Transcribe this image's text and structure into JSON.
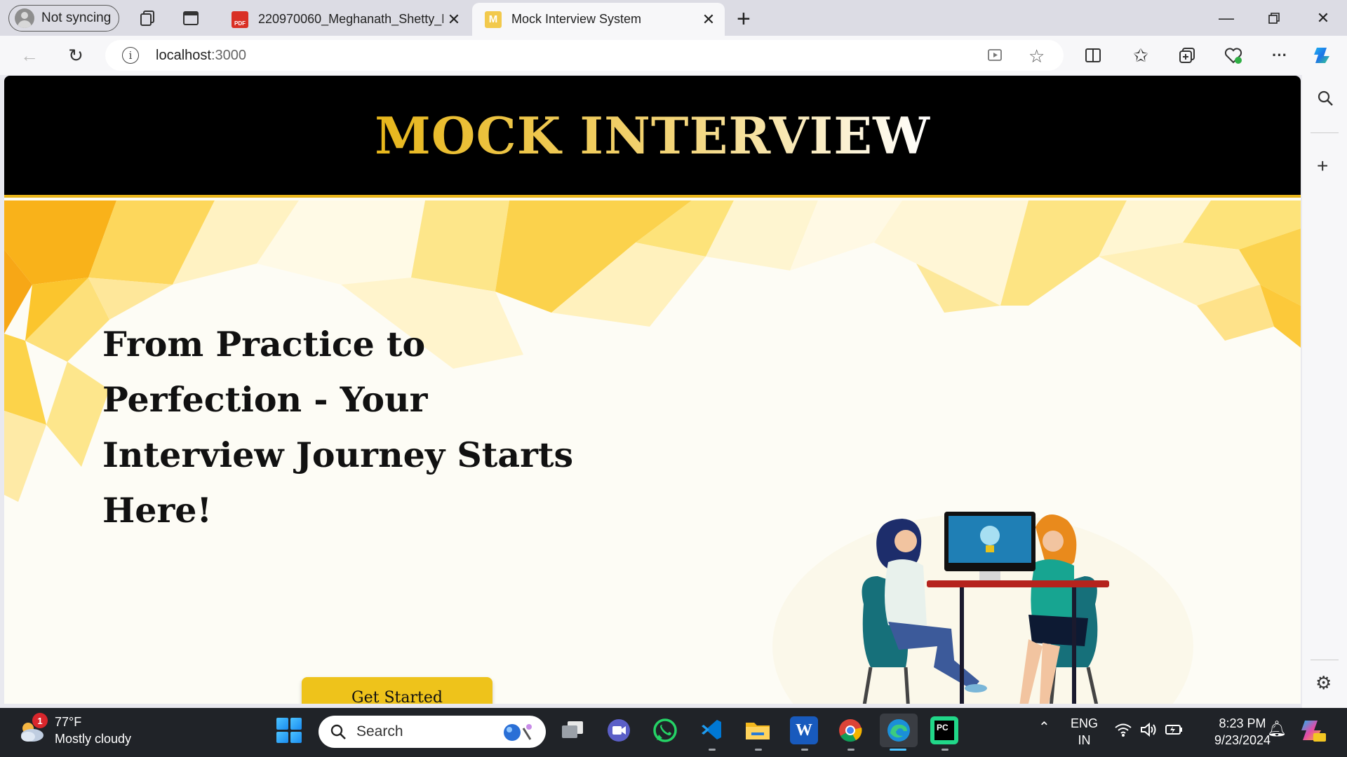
{
  "browser": {
    "profile_label": "Not syncing",
    "tabs": [
      {
        "title": "220970060_Meghanath_Shetty_F",
        "icon": "pdf-icon",
        "active": false
      },
      {
        "title": "Mock Interview System",
        "icon": "site-favicon",
        "active": true
      }
    ],
    "url_host": "localhost",
    "url_port": ":3000"
  },
  "page": {
    "site_title": "MOCK INTERVIEW",
    "headline": "From Practice to Perfection - Your Interview Journey Starts Here!",
    "cta_label": "Get Started",
    "colors": {
      "header_bg": "#000000",
      "accent": "#eec31b",
      "title_gold": "#e7b61a"
    }
  },
  "taskbar": {
    "weather_temp": "77°F",
    "weather_desc": "Mostly cloudy",
    "weather_badge": "1",
    "search_placeholder": "Search",
    "language_line1": "ENG",
    "language_line2": "IN",
    "time": "8:23 PM",
    "date": "9/23/2024",
    "apps": [
      "task-view-icon",
      "meet-icon",
      "whatsapp-icon",
      "vscode-icon",
      "file-explorer-icon",
      "word-icon",
      "chrome-icon",
      "edge-icon",
      "pycharm-icon"
    ]
  }
}
